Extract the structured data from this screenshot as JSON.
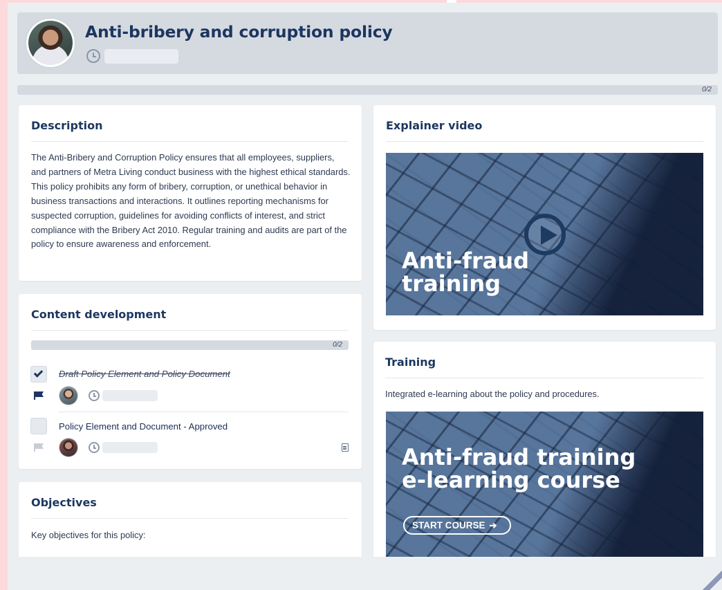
{
  "header": {
    "title": "Anti-bribery and corruption policy",
    "progress": "0/2",
    "progress_fraction": 0
  },
  "description": {
    "title": "Description",
    "text": "The Anti-Bribery and Corruption Policy ensures that all employees, suppliers, and partners of Metra Living conduct business with the highest ethical standards. This policy prohibits any form of bribery, corruption, or unethical behavior in business transactions and interactions. It outlines reporting mechanisms for suspected corruption, guidelines for avoiding conflicts of interest, and strict compliance with the Bribery Act 2010. Regular training and audits are part of the policy to ensure awareness and enforcement."
  },
  "content_development": {
    "title": "Content development",
    "progress": "0/2",
    "progress_fraction": 0,
    "tasks": [
      {
        "label": "Draft Policy Element and Policy Document",
        "done": true,
        "flag_color": "#1c365f"
      },
      {
        "label": "Policy Element and Document - Approved",
        "done": false,
        "flag_color": "#c8ced8"
      }
    ]
  },
  "objectives": {
    "title": "Objectives",
    "text": "Key objectives for this policy:"
  },
  "explainer": {
    "title": "Explainer video",
    "video_title": "Anti-fraud training"
  },
  "training": {
    "title": "Training",
    "subtitle": "Integrated e-learning about the policy and procedures.",
    "course_title": "Anti-fraud training e-learning course",
    "start_label": "START COURSE",
    "start_icon": "arrow-right-icon"
  },
  "colors": {
    "accent": "#1c365f",
    "panel": "#d5dae1",
    "background": "#eceff1",
    "side_strip": "#fcd9db"
  }
}
